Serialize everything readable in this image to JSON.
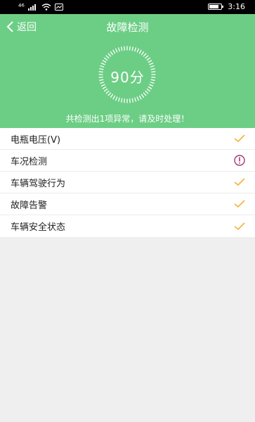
{
  "status_bar": {
    "signal": "⁴⁶",
    "time": "3:16"
  },
  "header": {
    "back_label": "返回",
    "title": "故障检测",
    "score": "90分",
    "summary": "共检测出1项异常，请及时处理！"
  },
  "colors": {
    "header_bg": "#6cce85",
    "check": "#f3b23b",
    "warning": "#a3357a"
  },
  "items": [
    {
      "label": "电瓶电压(V)",
      "status": "ok",
      "icon": "check-icon"
    },
    {
      "label": "车况检测",
      "status": "warning",
      "icon": "warning-icon"
    },
    {
      "label": "车辆驾驶行为",
      "status": "ok",
      "icon": "check-icon"
    },
    {
      "label": "故障告警",
      "status": "ok",
      "icon": "check-icon"
    },
    {
      "label": "车辆安全状态",
      "status": "ok",
      "icon": "check-icon"
    }
  ]
}
